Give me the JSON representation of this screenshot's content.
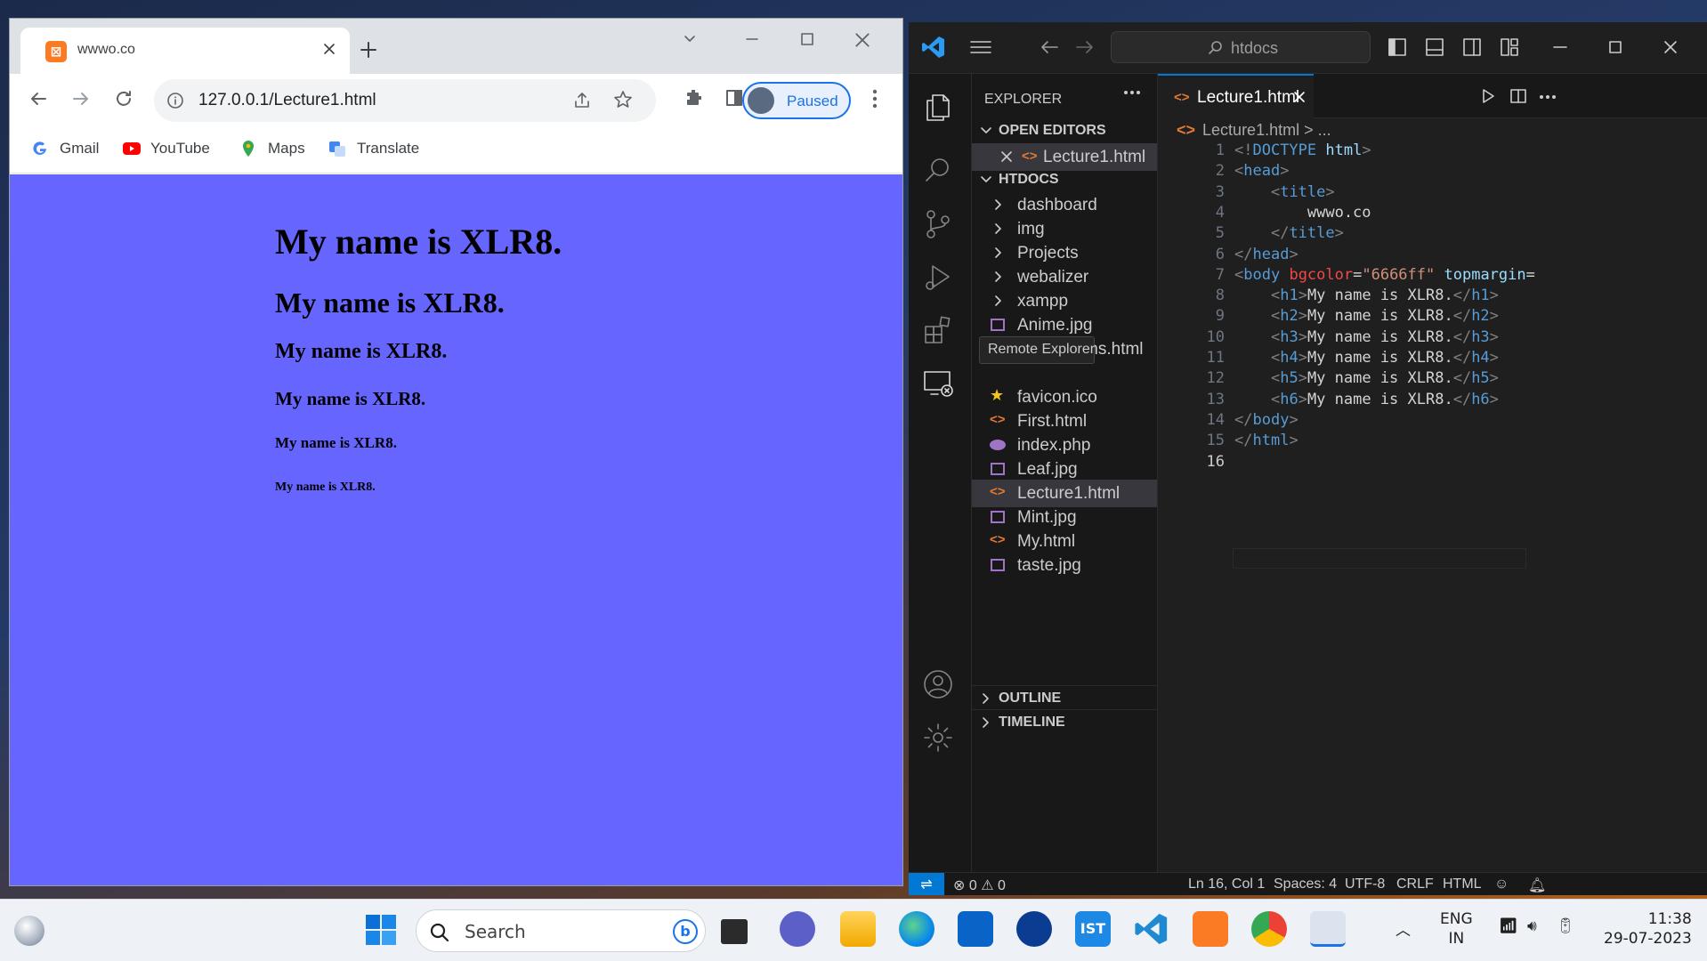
{
  "browser": {
    "tab_title": "wwwo.co",
    "url": "127.0.0.1/Lecture1.html",
    "profile_status": "Paused",
    "bookmarks": [
      "Gmail",
      "YouTube",
      "Maps",
      "Translate"
    ],
    "page_background": "#6666ff",
    "headings": [
      {
        "level": "h1",
        "text": "My name is XLR8."
      },
      {
        "level": "h2",
        "text": "My name is XLR8."
      },
      {
        "level": "h3",
        "text": "My name is XLR8."
      },
      {
        "level": "h4",
        "text": "My name is XLR8."
      },
      {
        "level": "h5",
        "text": "My name is XLR8."
      },
      {
        "level": "h6",
        "text": "My name is XLR8."
      }
    ]
  },
  "vscode": {
    "search_text": "htdocs",
    "explorer_title": "EXPLORER",
    "open_editors_label": "OPEN EDITORS",
    "open_editor_file": "Lecture1.html",
    "folder_label": "HTDOCS",
    "folders": [
      "dashboard",
      "img",
      "Projects",
      "webalizer",
      "xampp"
    ],
    "files": [
      {
        "name": "Anime.jpg",
        "icon": "image-icon"
      },
      {
        "name": "applications.html",
        "icon": "html-icon"
      },
      {
        "name": "favicon.ico",
        "icon": "star-icon"
      },
      {
        "name": "First.html",
        "icon": "html-icon"
      },
      {
        "name": "index.php",
        "icon": "php-icon"
      },
      {
        "name": "Leaf.jpg",
        "icon": "image-icon"
      },
      {
        "name": "Lecture1.html",
        "icon": "html-icon",
        "selected": true
      },
      {
        "name": "Mint.jpg",
        "icon": "image-icon"
      },
      {
        "name": "My.html",
        "icon": "html-icon"
      },
      {
        "name": "taste.jpg",
        "icon": "image-icon"
      }
    ],
    "tooltip": "Remote Explorer",
    "outline_label": "OUTLINE",
    "timeline_label": "TIMELINE",
    "editor_tab": "Lecture1.html",
    "breadcrumb": "Lecture1.html > ...",
    "code_lines": [
      "<!DOCTYPE html>",
      "<head>",
      "    <title>",
      "        wwwo.co",
      "    </title>",
      "</head>",
      "<body bgcolor=\"6666ff\" topmargin=",
      "    <h1>My name is XLR8.</h1>",
      "    <h2>My name is XLR8.</h2>",
      "    <h3>My name is XLR8.</h3>",
      "    <h4>My name is XLR8.</h4>",
      "    <h5>My name is XLR8.</h5>",
      "    <h6>My name is XLR8.</h6>",
      "</body>",
      "</html>",
      ""
    ],
    "status": {
      "errors": "0",
      "warnings": "0",
      "position": "Ln 16, Col 1",
      "spaces": "Spaces: 4",
      "encoding": "UTF-8",
      "eol": "CRLF",
      "language": "HTML"
    }
  },
  "taskbar": {
    "search_placeholder": "Search",
    "lang_line1": "ENG",
    "lang_line2": "IN",
    "time": "11:38",
    "date": "29-07-2023"
  }
}
